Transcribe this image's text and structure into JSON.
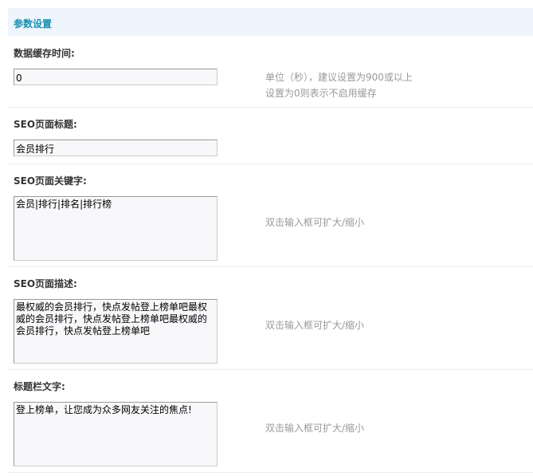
{
  "section_title": "参数设置",
  "fields": [
    {
      "label": "数据缓存时间:",
      "value": "0",
      "hint": [
        "单位（秒），建议设置为900或以上",
        "设置为0则表示不启用缓存"
      ]
    },
    {
      "label": "SEO页面标题:",
      "value": "会员排行"
    },
    {
      "label": "SEO页面关键字:",
      "value": "会员|排行|排名|排行榜",
      "hint": [
        "双击输入框可扩大/缩小"
      ]
    },
    {
      "label": "SEO页面描述:",
      "value": "最权威的会员排行，快点发帖登上榜单吧最权威的会员排行，快点发帖登上榜单吧最权威的会员排行，快点发帖登上榜单吧",
      "hint": [
        "双击输入框可扩大/缩小"
      ]
    },
    {
      "label": "标题栏文字:",
      "value": "登上榜单，让您成为众多网友关注的焦点!",
      "hint": [
        "双击输入框可扩大/缩小"
      ]
    }
  ]
}
